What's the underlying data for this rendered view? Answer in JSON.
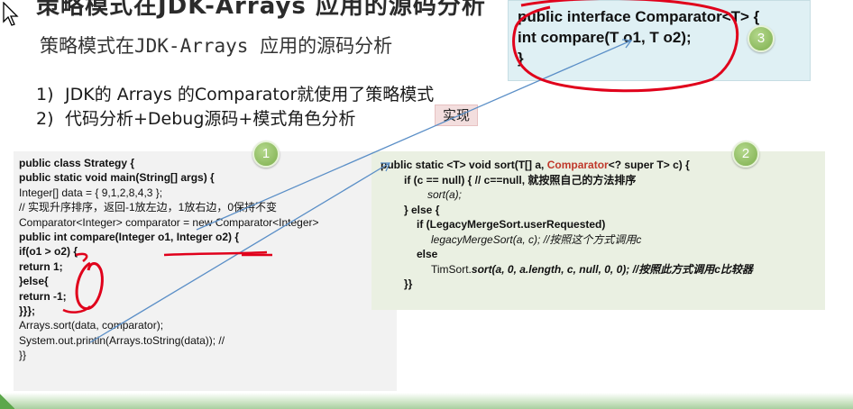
{
  "header": {
    "top_title_cropped": "策略模式在JDK-Arrays 应用的源码分析",
    "subtitle": "策略模式在JDK-Arrays 应用的源码分析"
  },
  "bullets": [
    {
      "num": "1)",
      "text": "JDK的 Arrays 的Comparator就使用了策略模式"
    },
    {
      "num": "2)",
      "text": "代码分析+Debug源码+模式角色分析"
    }
  ],
  "impl_badge": "实现",
  "interface_box": {
    "lines": [
      "public interface Comparator<T> {",
      "int compare(T o1, T o2);",
      "}"
    ]
  },
  "badges": {
    "one": "1",
    "two": "2",
    "three": "3"
  },
  "code_left": {
    "lines": [
      "public class Strategy {",
      "public static void main(String[] args) {",
      "Integer[] data = { 9,1,2,8,4,3 };",
      "// 实现升序排序，返回-1放左边，1放右边，0保持不变",
      "Comparator<Integer> comparator = new Comparator<Integer>",
      "public int compare(Integer o1, Integer o2) {",
      "if(o1 > o2) {",
      "return 1;",
      "}else{",
      "return -1;",
      "}}};",
      "Arrays.sort(data, comparator);",
      "System.out.println(Arrays.toString(data)); //",
      "}}"
    ]
  },
  "code_right": {
    "line1_prefix": "public static <T> void sort(T[] a, ",
    "line1_red": "Comparator",
    "line1_suffix": "<? super T> c) {",
    "line2": "if (c == null) { // c==null, 就按照自己的方法排序",
    "line3": "sort(a);",
    "line4": "} else {",
    "line5": "if (LegacyMergeSort.userRequested)",
    "line6": "legacyMergeSort(a, c); //按照这个方式调用c",
    "line7": "else",
    "line8_prefix": "TimSort.",
    "line8_italic": "sort(a, 0, a.length, c, null, 0, 0); //按照此方式调用c比较器",
    "line9": "}}"
  },
  "colors": {
    "annotation_red": "#e0001b",
    "arrow_blue": "#5b8fc7",
    "badge_green": "#8cbf5a",
    "iface_bg": "#dff0f4",
    "right_code_bg": "#eaf0e2",
    "left_code_bg": "#f2f2f2"
  }
}
